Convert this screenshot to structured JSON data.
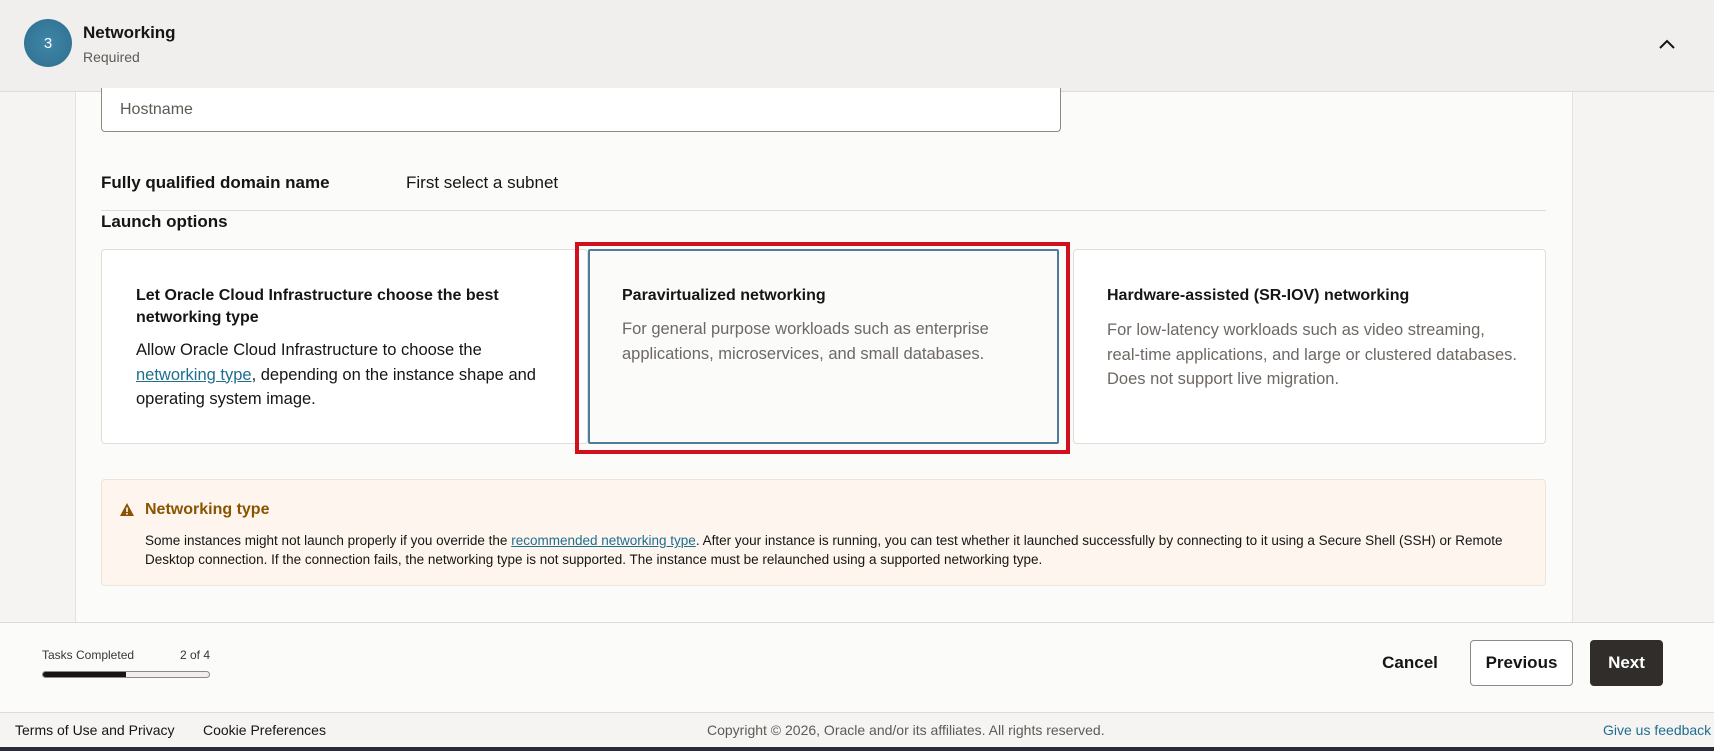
{
  "step": {
    "number": "3",
    "title": "Networking",
    "status": "Required"
  },
  "form": {
    "hostname_value": "Hostname",
    "fqdn_label": "Fully qualified domain name",
    "fqdn_value": "First select a subnet",
    "launch_options_label": "Launch options"
  },
  "cards": [
    {
      "title": "Let Oracle Cloud Infrastructure choose the best networking type",
      "desc_before": "Allow Oracle Cloud Infrastructure to choose the ",
      "desc_link": "networking type",
      "desc_after": ", depending on the instance shape and operating system image."
    },
    {
      "title": "Paravirtualized networking",
      "desc": "For general purpose workloads such as enterprise applications, microservices, and small databases."
    },
    {
      "title": "Hardware-assisted (SR-IOV) networking",
      "desc": "For low-latency workloads such as video streaming, real-time applications, and large or clustered databases. Does not support live migration."
    }
  ],
  "warning": {
    "title": "Networking type",
    "text_before": "Some instances might not launch properly if you override the ",
    "link": "recommended networking type",
    "text_after": ". After your instance is running, you can test whether it launched successfully by connecting to it using a Secure Shell (SSH) or Remote Desktop connection. If the connection fails, the networking type is not supported. The instance must be relaunched using a supported networking type."
  },
  "progress": {
    "label": "Tasks Completed",
    "count": "2 of 4",
    "fraction": 0.5
  },
  "buttons": {
    "cancel": "Cancel",
    "previous": "Previous",
    "next": "Next"
  },
  "footer": {
    "terms": "Terms of Use and Privacy",
    "cookies": "Cookie Preferences",
    "copyright": "Copyright © 2026, Oracle and/or its affiliates. All rights reserved.",
    "feedback": "Give us feedback"
  },
  "colors": {
    "accent": "#1e6e90",
    "selected_border": "#4f7d99",
    "highlight": "#d0101c",
    "warning": "#8a5300",
    "primary_button": "#312d2a"
  }
}
